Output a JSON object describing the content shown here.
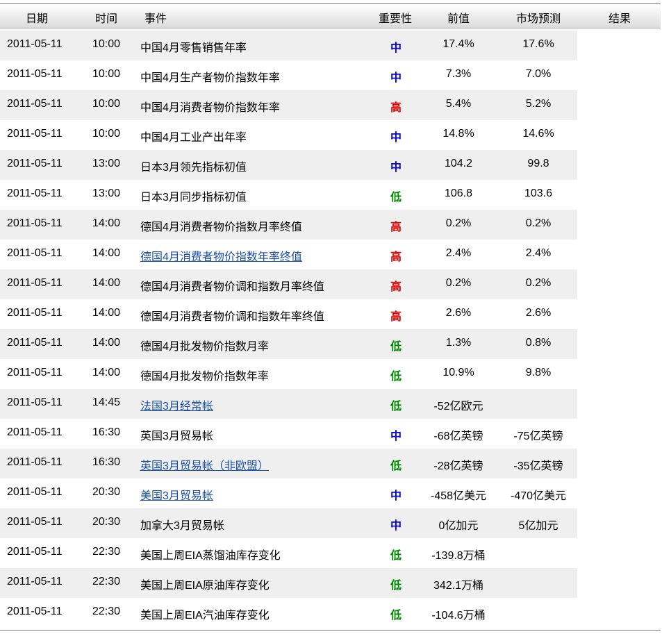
{
  "header": {
    "date": "日期",
    "time": "时间",
    "event": "事件",
    "importance": "重要性",
    "previous": "前值",
    "forecast": "市场预测",
    "result": "结果"
  },
  "colors": {
    "高": "#e00000",
    "中": "#0000e0",
    "低": "#008a00",
    "link": "#1a4fa8",
    "stripe": "#efefef"
  },
  "rows": [
    {
      "date": "2011-05-11",
      "time": "10:00",
      "event": "中国4月零售销售年率",
      "link": false,
      "importance": "中",
      "previous": "17.4%",
      "forecast": "17.6%",
      "result": ""
    },
    {
      "date": "2011-05-11",
      "time": "10:00",
      "event": "中国4月生产者物价指数年率",
      "link": false,
      "importance": "中",
      "previous": "7.3%",
      "forecast": "7.0%",
      "result": ""
    },
    {
      "date": "2011-05-11",
      "time": "10:00",
      "event": "中国4月消费者物价指数年率",
      "link": false,
      "importance": "高",
      "previous": "5.4%",
      "forecast": "5.2%",
      "result": ""
    },
    {
      "date": "2011-05-11",
      "time": "10:00",
      "event": "中国4月工业产出年率",
      "link": false,
      "importance": "中",
      "previous": "14.8%",
      "forecast": "14.6%",
      "result": ""
    },
    {
      "date": "2011-05-11",
      "time": "13:00",
      "event": "日本3月领先指标初值",
      "link": false,
      "importance": "中",
      "previous": "104.2",
      "forecast": "99.8",
      "result": ""
    },
    {
      "date": "2011-05-11",
      "time": "13:00",
      "event": "日本3月同步指标初值",
      "link": false,
      "importance": "低",
      "previous": "106.8",
      "forecast": "103.6",
      "result": ""
    },
    {
      "date": "2011-05-11",
      "time": "14:00",
      "event": "德国4月消费者物价指数月率终值",
      "link": false,
      "importance": "高",
      "previous": "0.2%",
      "forecast": "0.2%",
      "result": ""
    },
    {
      "date": "2011-05-11",
      "time": "14:00",
      "event": "德国4月消费者物价指数年率终值",
      "link": true,
      "importance": "高",
      "previous": "2.4%",
      "forecast": "2.4%",
      "result": ""
    },
    {
      "date": "2011-05-11",
      "time": "14:00",
      "event": "德国4月消费者物价调和指数月率终值",
      "link": false,
      "importance": "高",
      "previous": "0.2%",
      "forecast": "0.2%",
      "result": ""
    },
    {
      "date": "2011-05-11",
      "time": "14:00",
      "event": "德国4月消费者物价调和指数年率终值",
      "link": false,
      "importance": "高",
      "previous": "2.6%",
      "forecast": "2.6%",
      "result": ""
    },
    {
      "date": "2011-05-11",
      "time": "14:00",
      "event": "德国4月批发物价指数月率",
      "link": false,
      "importance": "低",
      "previous": "1.3%",
      "forecast": "0.8%",
      "result": ""
    },
    {
      "date": "2011-05-11",
      "time": "14:00",
      "event": "德国4月批发物价指数年率",
      "link": false,
      "importance": "低",
      "previous": "10.9%",
      "forecast": "9.8%",
      "result": ""
    },
    {
      "date": "2011-05-11",
      "time": "14:45",
      "event": "法国3月经常帐",
      "link": true,
      "importance": "低",
      "previous": "-52亿欧元",
      "forecast": "",
      "result": ""
    },
    {
      "date": "2011-05-11",
      "time": "16:30",
      "event": "英国3月贸易帐",
      "link": false,
      "importance": "中",
      "previous": "-68亿英镑",
      "forecast": "-75亿英镑",
      "result": ""
    },
    {
      "date": "2011-05-11",
      "time": "16:30",
      "event": "英国3月贸易帐（非欧盟）",
      "link": true,
      "importance": "低",
      "previous": "-28亿英镑",
      "forecast": "-35亿英镑",
      "result": ""
    },
    {
      "date": "2011-05-11",
      "time": "20:30",
      "event": "美国3月贸易帐",
      "link": true,
      "importance": "中",
      "previous": "-458亿美元",
      "forecast": "-470亿美元",
      "result": ""
    },
    {
      "date": "2011-05-11",
      "time": "20:30",
      "event": "加拿大3月贸易帐",
      "link": false,
      "importance": "中",
      "previous": "0亿加元",
      "forecast": "5亿加元",
      "result": ""
    },
    {
      "date": "2011-05-11",
      "time": "22:30",
      "event": "美国上周EIA蒸馏油库存变化",
      "link": false,
      "importance": "低",
      "previous": "-139.8万桶",
      "forecast": "",
      "result": ""
    },
    {
      "date": "2011-05-11",
      "time": "22:30",
      "event": "美国上周EIA原油库存变化",
      "link": false,
      "importance": "低",
      "previous": "342.1万桶",
      "forecast": "",
      "result": ""
    },
    {
      "date": "2011-05-11",
      "time": "22:30",
      "event": "美国上周EIA汽油库存变化",
      "link": false,
      "importance": "低",
      "previous": "-104.6万桶",
      "forecast": "",
      "result": ""
    }
  ]
}
